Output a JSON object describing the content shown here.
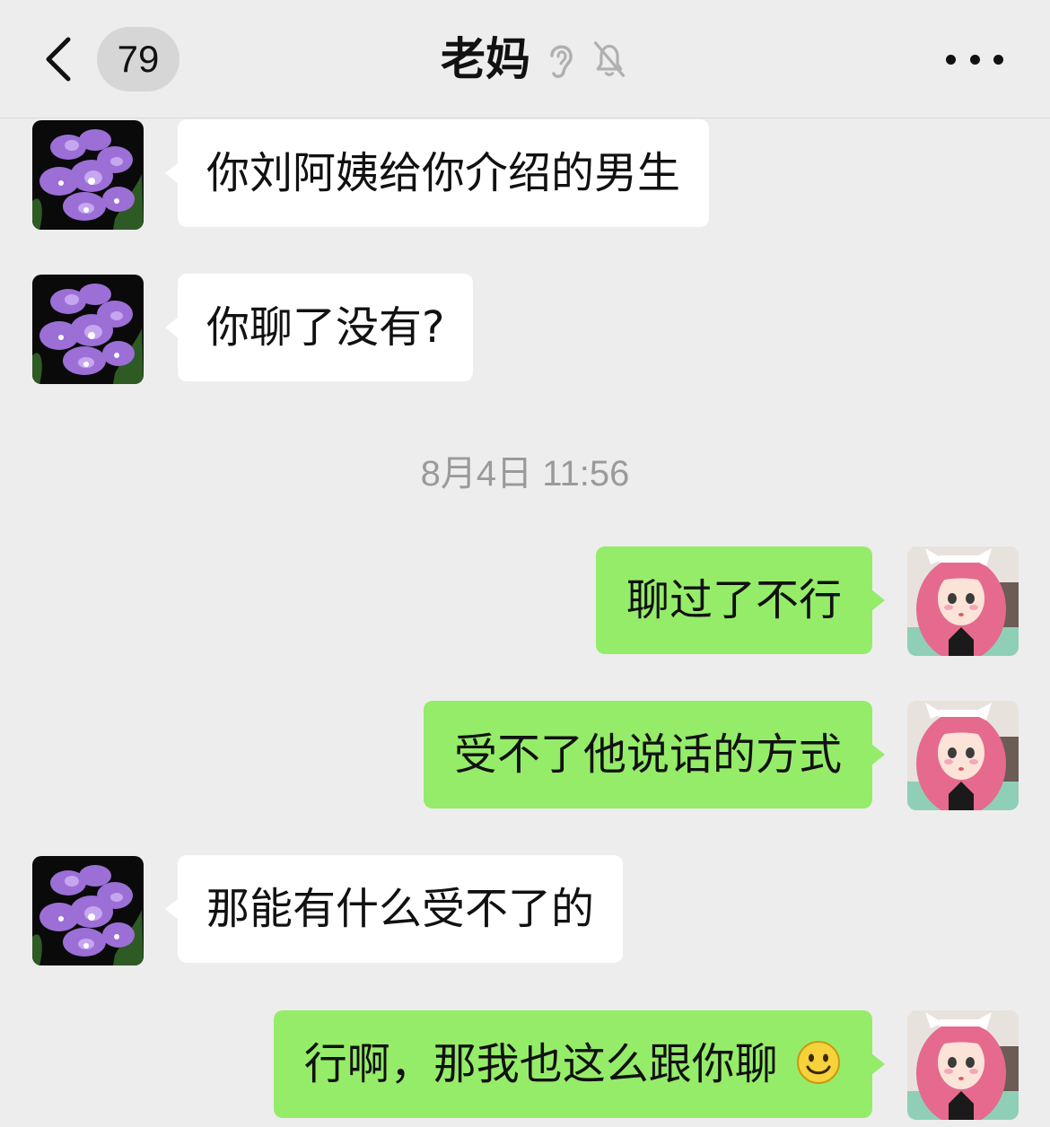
{
  "header": {
    "back_icon": "chevron-left-icon",
    "unread_count": "79",
    "title": "老妈",
    "ear_icon": "ear-icon",
    "mute_icon": "bell-slash-icon",
    "more_icon": "more-dots-icon"
  },
  "colors": {
    "background": "#ededed",
    "incoming_bubble": "#ffffff",
    "outgoing_bubble": "#95ec69",
    "timestamp": "#9a9a9a"
  },
  "messages": [
    {
      "from": "mom",
      "text": "你刘阿姨给你介绍的男生"
    },
    {
      "from": "mom",
      "text": "你聊了没有?"
    },
    {
      "from": "me",
      "text": "聊过了不行"
    },
    {
      "from": "me",
      "text": "受不了他说话的方式"
    },
    {
      "from": "mom",
      "text": "那能有什么受不了的"
    },
    {
      "from": "me",
      "text": "行啊，那我也这么跟你聊",
      "emoji": "smiley-face-icon"
    }
  ],
  "timestamp": "8月4日 11:56",
  "avatars": {
    "mom": "purple-orchid-avatar",
    "me": "pink-hair-girl-avatar"
  }
}
